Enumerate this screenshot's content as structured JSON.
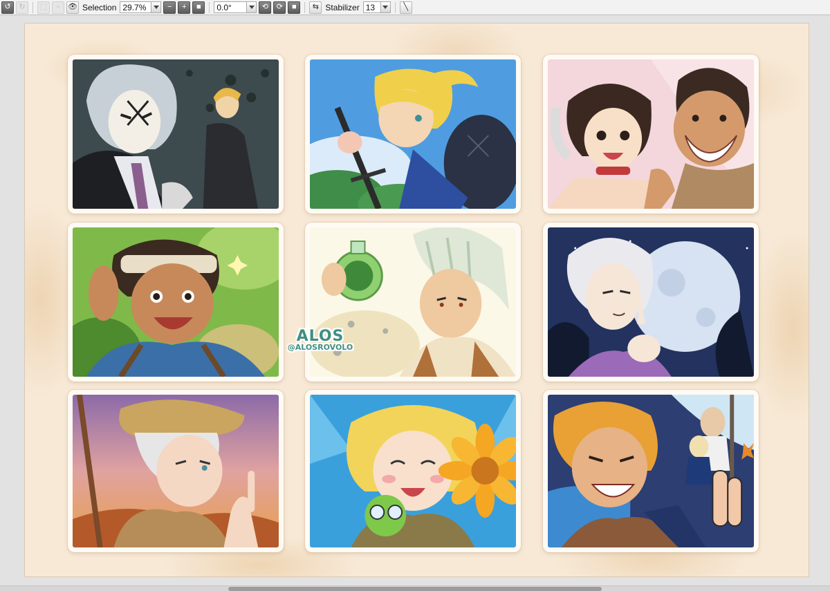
{
  "toolbar": {
    "selection_label": "Selection",
    "zoom_value": "29.7%",
    "angle_value": "0.0°",
    "stabilizer_label": "Stabilizer",
    "stabilizer_value": "13"
  },
  "canvas": {
    "watermark_title": "ALOS",
    "watermark_handle": "@ALOSROVOLO"
  },
  "colors": {
    "canvas_bg": "#f7e9d6",
    "watermark": "#3f8f84"
  }
}
